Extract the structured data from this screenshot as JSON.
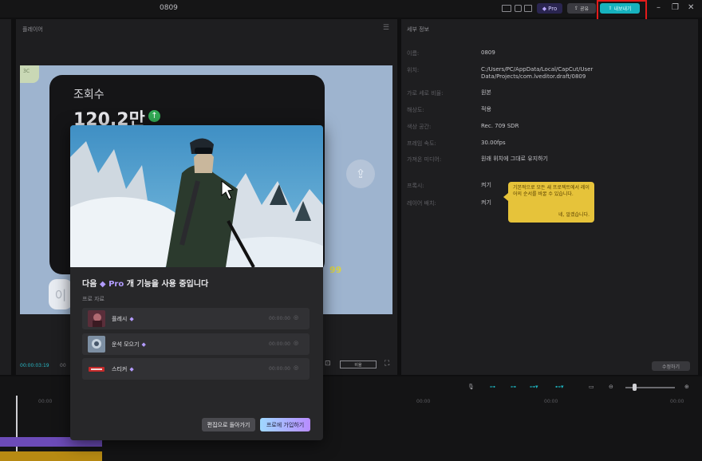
{
  "titlebar": {
    "project_title": "0809",
    "pro_label": "Pro",
    "share_label": "공유",
    "export_label": "내보내기",
    "accent": "#17b2be"
  },
  "player": {
    "title": "플레이어",
    "views_label": "조회수",
    "views_value": "120.2만",
    "small_tag": "3C",
    "number_badge": "99",
    "card_char": "이",
    "time_current": "00:00:03:19",
    "time_total": "00",
    "ratio_label": "비율",
    "menu_icon": "menu-icon"
  },
  "details": {
    "title": "세부 정보",
    "rows": [
      {
        "key": "이름:",
        "value": "0809"
      },
      {
        "key": "위치:",
        "value": "C:/Users/PC/AppData/Local/CapCut/User Data/Projects/com.lveditor.draft/0809"
      },
      {
        "key": "가로 세로 비율:",
        "value": "원본"
      },
      {
        "key": "해상도:",
        "value": "적용"
      },
      {
        "key": "색상 공간:",
        "value": "Rec. 709 SDR"
      },
      {
        "key": "프레임 속도:",
        "value": "30.00fps"
      },
      {
        "key": "가져온 미디어:",
        "value": "원래 위치에 그대로 유지하기"
      },
      {
        "key": "프록시:",
        "value": "켜기"
      },
      {
        "key": "레이어 배치:",
        "value": "켜기"
      }
    ],
    "tooltip_text": "기본적으로 모든 새 프로젝트에서 레이어의 순서를 바꿀 수 있습니다.",
    "tooltip_ok": "네, 알겠습니다.",
    "modify_label": "수정하기"
  },
  "dialog": {
    "heading_prefix": "다음",
    "heading_pro": "Pro",
    "heading_suffix": "개 기능을 사용 중입니다",
    "sub_label": "프로 자료",
    "items": [
      {
        "name": "플레시",
        "time": "00:00:00"
      },
      {
        "name": "운석 모으기",
        "time": "00:00:00"
      },
      {
        "name": "스티커",
        "time": "00:00:00"
      }
    ],
    "back_label": "편집으로 돌아가기",
    "join_label": "프로에 가입하기",
    "pro_color": "#b29cff"
  },
  "timeline": {
    "ruler": [
      "00:00",
      "00:00",
      "00:00",
      "00:00"
    ],
    "zoom_level": 0.15
  }
}
